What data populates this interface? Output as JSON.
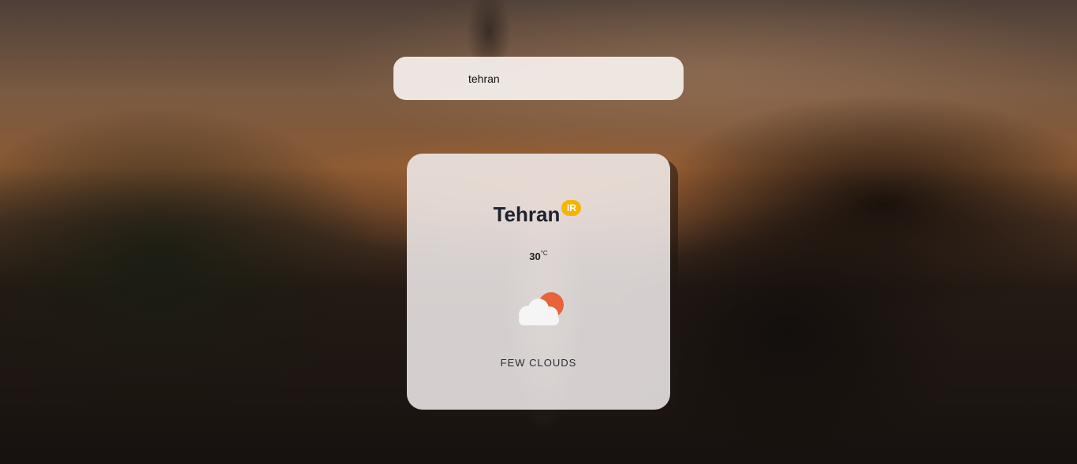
{
  "search": {
    "value": "tehran"
  },
  "weather": {
    "city": "Tehran",
    "country_code": "IR",
    "temperature": "30",
    "unit": "°C",
    "description": "FEW CLOUDS",
    "icon": "few-clouds-icon"
  },
  "colors": {
    "badge": "#f4b400",
    "sun": "#e8623a",
    "cloud": "#f5f5f5",
    "city_text": "#1e2130"
  }
}
